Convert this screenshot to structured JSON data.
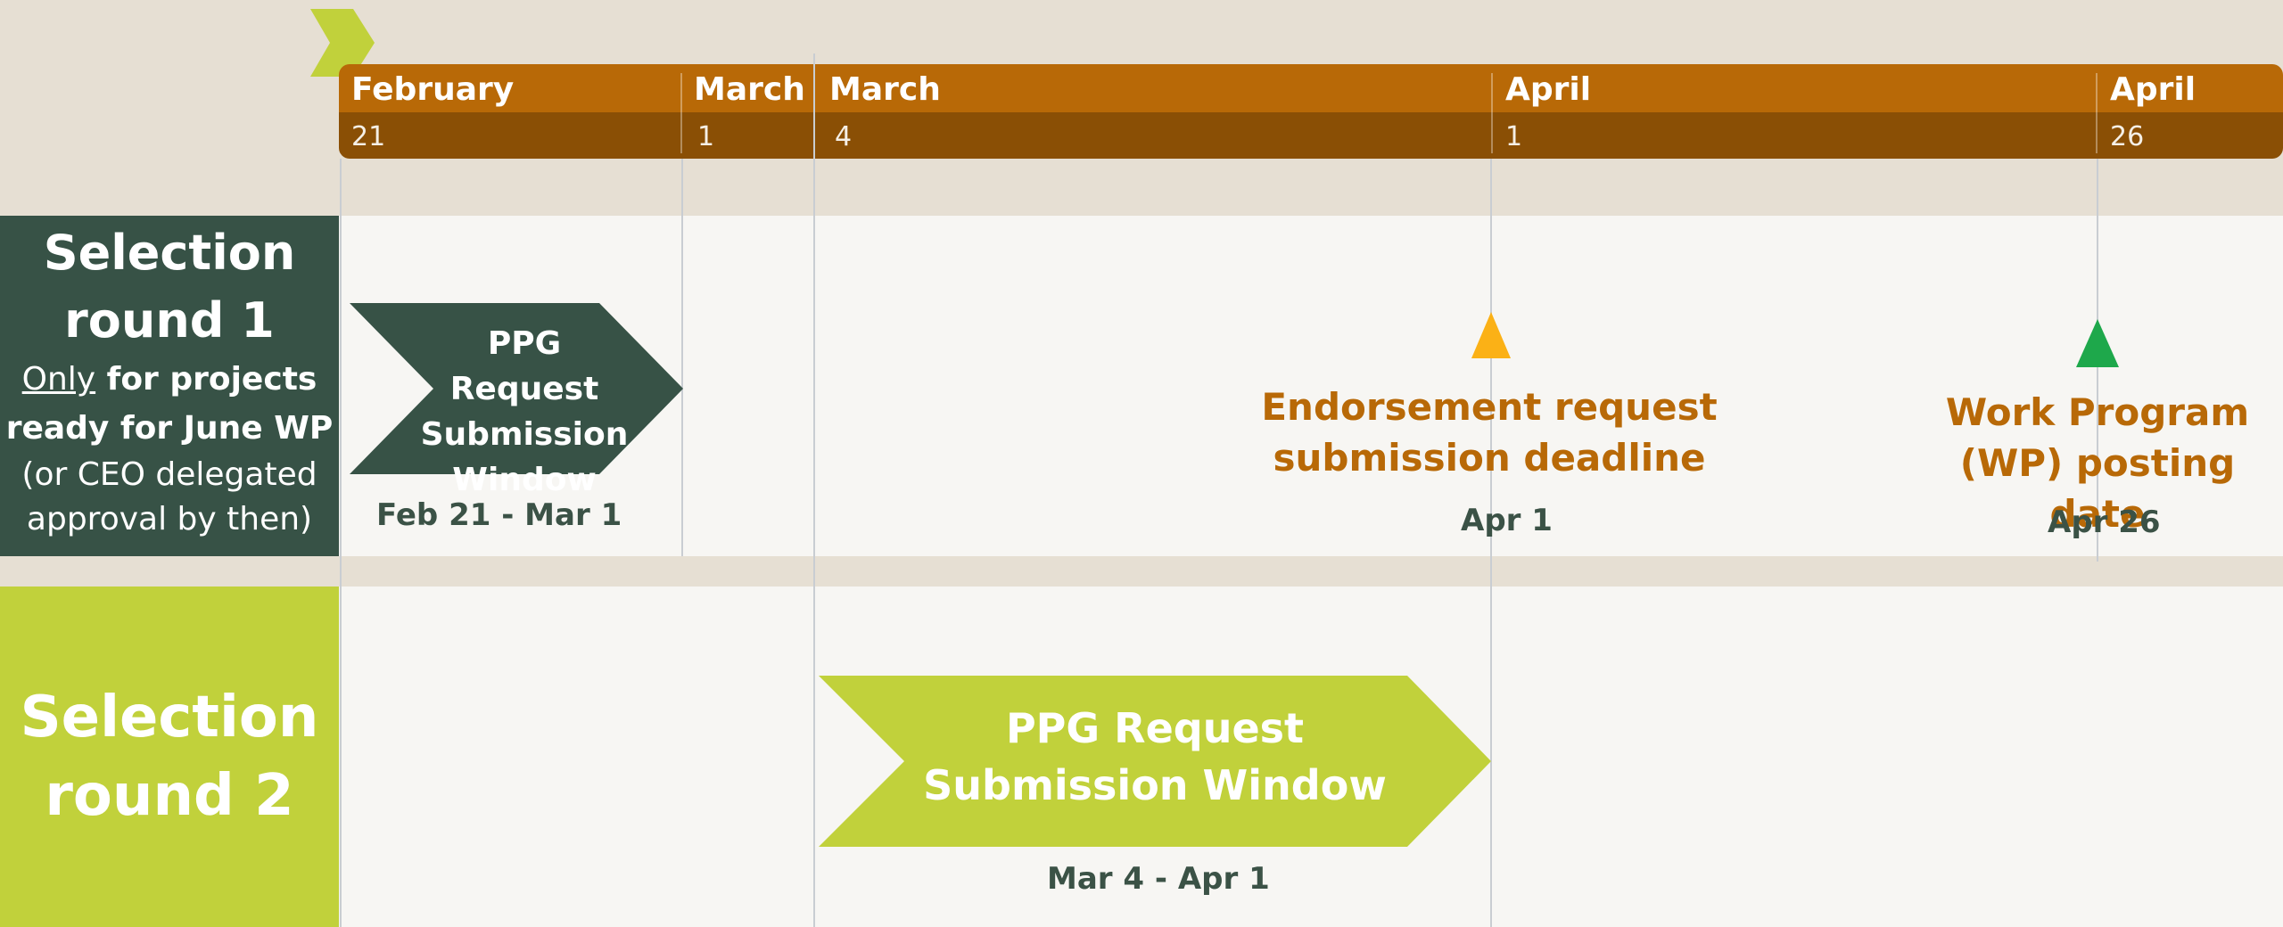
{
  "timescale": {
    "months": [
      "February",
      "March",
      "March",
      "April",
      "April"
    ],
    "days": [
      "21",
      "1",
      "4",
      "1",
      "26"
    ]
  },
  "lanes": [
    {
      "title": "Selection round 1",
      "note": {
        "underlined": "Only",
        "bold_rest": " for projects",
        "bold_line2": "ready for June WP",
        "normal_line1": "(or CEO delegated",
        "normal_line2": "approval by then)"
      },
      "task": {
        "label": "PPG Request Submission Window",
        "dates": "Feb 21 - Mar 1",
        "color": "#375246"
      },
      "milestones": [
        {
          "label": "Endorsement request submission deadline",
          "date": "Apr 1",
          "color": "#fbb116"
        },
        {
          "label": "Work Program (WP) posting date",
          "date": "Apr 26",
          "color": "#1ea84b"
        }
      ],
      "color": "#375246"
    },
    {
      "title": "Selection round 2",
      "task": {
        "label": "PPG Request Submission Window",
        "dates": "Mar 4 - Apr 1",
        "color": "#c1d13b"
      },
      "color": "#c1d13b"
    }
  ],
  "colors": {
    "month_bar": "#b86907",
    "day_bar": "#8a4f05",
    "today_marker": "#c1d13b",
    "milestone_text": "#b86907"
  }
}
